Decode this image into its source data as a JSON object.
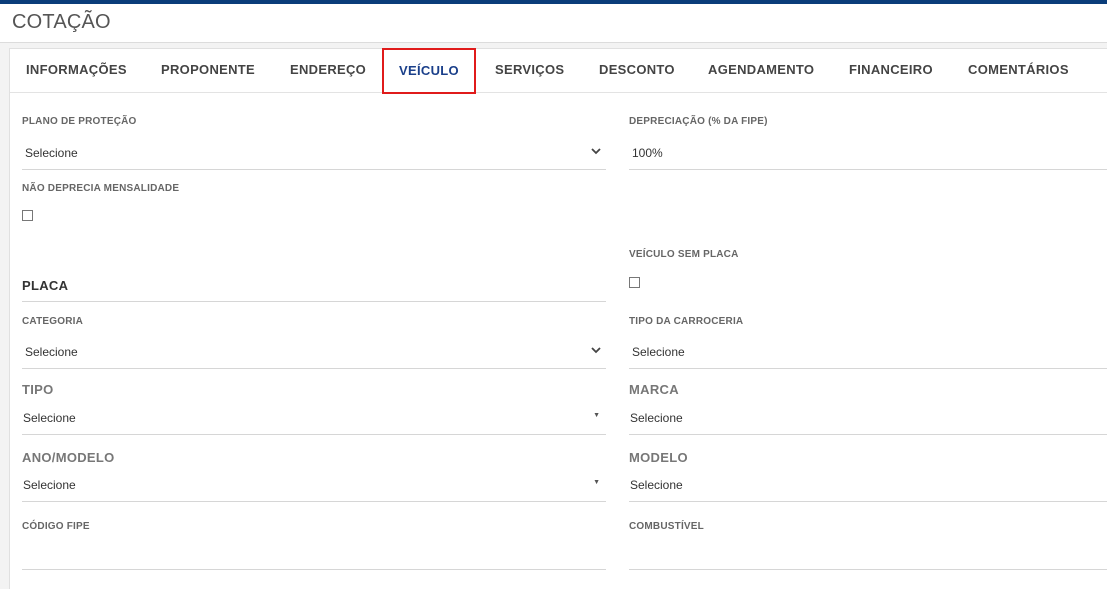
{
  "header": {
    "title": "COTAÇÃO"
  },
  "tabs": [
    {
      "label": "INFORMAÇÕES"
    },
    {
      "label": "PROPONENTE"
    },
    {
      "label": "ENDEREÇO"
    },
    {
      "label": "VEÍCULO",
      "active": true
    },
    {
      "label": "SERVIÇOS"
    },
    {
      "label": "DESCONTO"
    },
    {
      "label": "AGENDAMENTO"
    },
    {
      "label": "FINANCEIRO"
    },
    {
      "label": "COMENTÁRIOS"
    }
  ],
  "form": {
    "plano_protecao": {
      "label": "PLANO DE PROTEÇÃO",
      "value": "Selecione"
    },
    "depreciacao": {
      "label": "DEPRECIAÇÃO (% DA FIPE)",
      "value": "100%"
    },
    "nao_deprecia": {
      "label": "NÃO DEPRECIA MENSALIDADE",
      "checked": false
    },
    "veiculo_sem_placa": {
      "label": "VEÍCULO SEM PLACA",
      "checked": false
    },
    "placa": {
      "label": "PLACA",
      "value": ""
    },
    "categoria": {
      "label": "CATEGORIA",
      "value": "Selecione"
    },
    "tipo_carroceria": {
      "label": "TIPO DA CARROCERIA",
      "value": "Selecione"
    },
    "tipo": {
      "label": "TIPO",
      "value": "Selecione"
    },
    "marca": {
      "label": "MARCA",
      "value": "Selecione"
    },
    "ano_modelo": {
      "label": "ANO/MODELO",
      "value": "Selecione"
    },
    "modelo": {
      "label": "MODELO",
      "value": "Selecione"
    },
    "codigo_fipe": {
      "label": "CÓDIGO FIPE",
      "value": ""
    },
    "combustivel": {
      "label": "COMBUSTÍVEL",
      "value": ""
    }
  },
  "colors": {
    "accent": "#0a3d7a",
    "active_tab_text": "#1a3f8a",
    "highlight_border": "#e01b1b"
  }
}
